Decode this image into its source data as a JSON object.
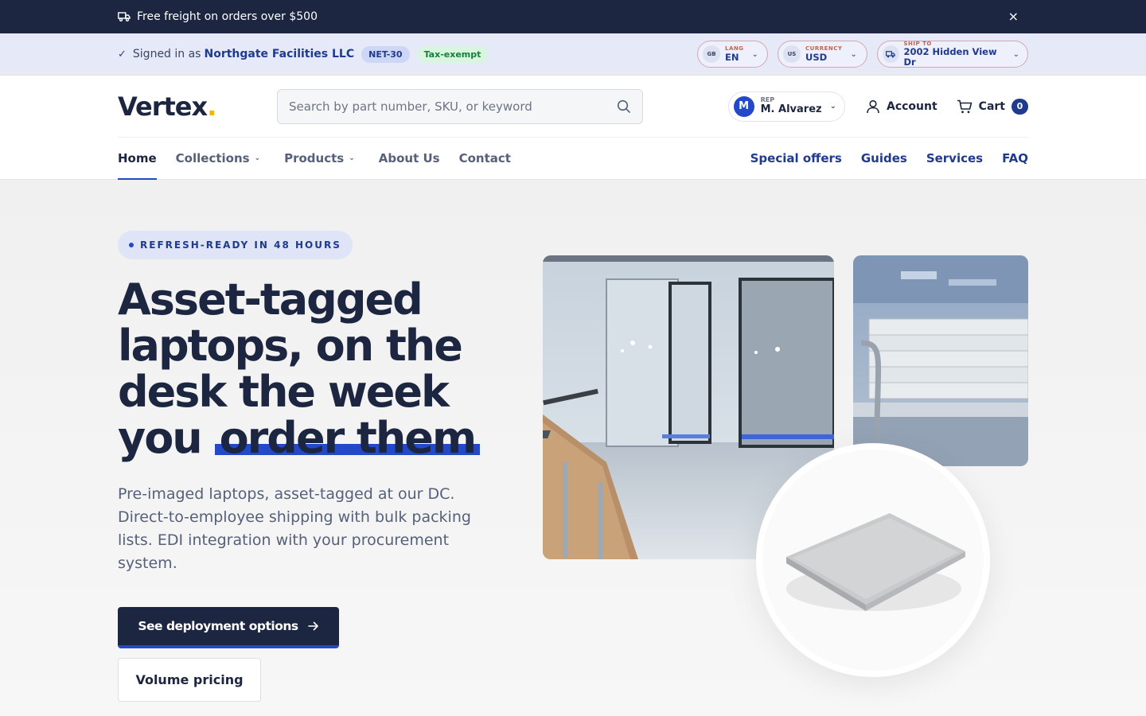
{
  "announcement": {
    "text": "Free freight on orders over $500",
    "close": "×"
  },
  "account_bar": {
    "signed_in_prefix": "Signed in as",
    "company": "Northgate Facilities LLC",
    "terms_badge": "NET-30",
    "tax_badge": "Tax-exempt",
    "language": {
      "code": "GB",
      "label": "LANG",
      "value": "EN"
    },
    "currency": {
      "code": "US",
      "label": "CURRENCY",
      "value": "USD"
    },
    "ship_to": {
      "label": "SHIP TO",
      "value": "2002 Hidden View Dr"
    }
  },
  "header": {
    "logo": "Vertex",
    "logo_dot": ".",
    "search_placeholder": "Search by part number, SKU, or keyword",
    "rep": {
      "initial": "M",
      "label": "REP",
      "name": "M. Alvarez"
    },
    "account_label": "Account",
    "cart_label": "Cart",
    "cart_count": "0"
  },
  "nav": {
    "left": [
      {
        "label": "Home",
        "active": true
      },
      {
        "label": "Collections",
        "dropdown": true
      },
      {
        "label": "Products",
        "dropdown": true
      },
      {
        "label": "About Us"
      },
      {
        "label": "Contact"
      }
    ],
    "right": [
      "Special offers",
      "Guides",
      "Services",
      "FAQ"
    ]
  },
  "hero": {
    "badge": "REFRESH-READY IN 48 HOURS",
    "headline_line1": "Asset-tagged",
    "headline_line2": "laptops, on the",
    "headline_line3": "desk the week",
    "headline_line4_plain": "you",
    "headline_highlight": "order them",
    "subcopy": "Pre-imaged laptops, asset-tagged at our DC. Direct-to-employee shipping with bulk packing lists. EDI integration with your procurement system.",
    "primary_cta": "See deployment options",
    "secondary_cta": "Volume pricing"
  },
  "colors": {
    "navy": "#1c2640",
    "accent_blue": "#2348c8",
    "logo_dot": "#f5b400",
    "tax_green": "#16803b"
  }
}
